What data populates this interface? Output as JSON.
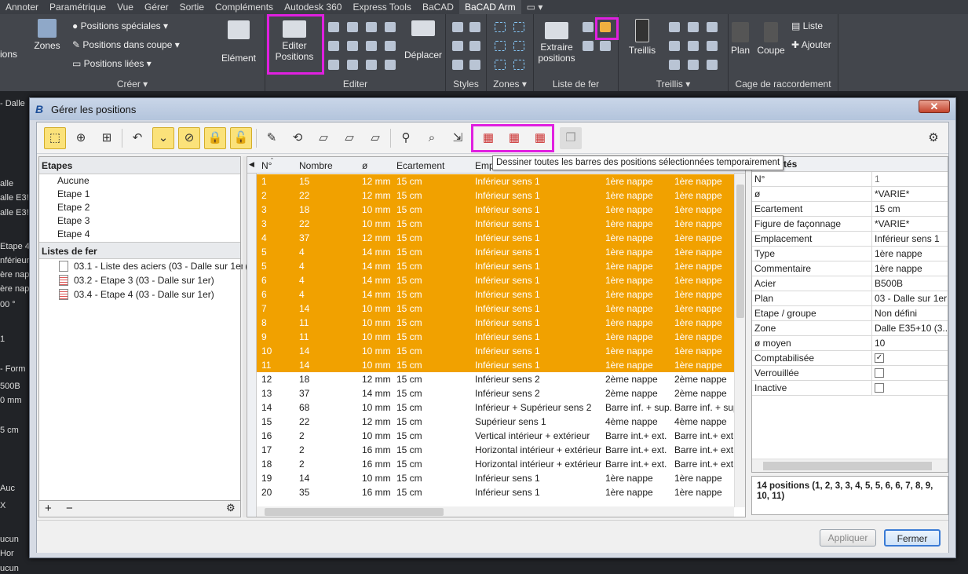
{
  "ribbon_tabs": [
    "Annoter",
    "Paramétrique",
    "Vue",
    "Gérer",
    "Sortie",
    "Compléments",
    "Autodesk 360",
    "Express Tools",
    "BaCAD",
    "BaCAD Arm",
    "▭ ▾"
  ],
  "ribbon": {
    "creer": {
      "label": "Créer ▾",
      "ions": "ions",
      "zones": "Zones",
      "pos_speciales": "Positions spéciales ▾",
      "pos_coupe": "Positions dans coupe ▾",
      "pos_liees": "Positions liées ▾",
      "element": "Elément"
    },
    "editer": {
      "label": "Editer",
      "editer_positions": "Editer Positions",
      "deplacer": "Déplacer"
    },
    "styles": {
      "label": "Styles"
    },
    "zones": {
      "label": "Zones ▾"
    },
    "liste": {
      "label": "Liste de fer",
      "extraire": "Extraire positions"
    },
    "treillis": {
      "label": "Treillis ▾",
      "treillis": "Treillis"
    },
    "cage": {
      "label": "Cage de raccordement",
      "plan": "Plan",
      "coupe": "Coupe",
      "liste": "Liste",
      "ajouter": "Ajouter"
    }
  },
  "left_strip": [
    "- Dalle",
    "alle",
    "alle E3!",
    "alle E3!",
    "Etape 4",
    "nférieur",
    "ère nap",
    "ère nap",
    "00 °",
    "1",
    "- Form",
    "500B",
    "0 mm",
    "5 cm",
    "Auc",
    "X",
    "ucun",
    "Hor",
    "ucun"
  ],
  "dialog": {
    "title": "Gérer les positions",
    "close": "✕",
    "tooltip": "Dessiner toutes les barres des positions sélectionnées temporairement",
    "etapes_header": "Etapes",
    "etapes": [
      "Aucune",
      "Etape 1",
      "Etape 2",
      "Etape 3",
      "Etape 4"
    ],
    "listes_header": "Listes de fer",
    "listes": [
      "03.1 - Liste des aciers (03 - Dalle sur 1er)",
      "03.2 - Etape 3 (03 - Dalle sur 1er)",
      "03.4 - Etape 4 (03 - Dalle sur 1er)"
    ],
    "footer": {
      "plus": "+",
      "minus": "−",
      "gear": "⚙"
    },
    "columns": [
      "N°",
      "Nombre",
      "ø",
      "Ecartement",
      "Emp",
      "",
      "",
      ""
    ],
    "rows": [
      [
        "1",
        "15",
        "12 mm",
        "15 cm",
        "Inférieur sens 1",
        "1ère nappe",
        "1ère nappe"
      ],
      [
        "2",
        "22",
        "12 mm",
        "15 cm",
        "Inférieur sens 1",
        "1ère nappe",
        "1ère nappe"
      ],
      [
        "3",
        "18",
        "10 mm",
        "15 cm",
        "Inférieur sens 1",
        "1ère nappe",
        "1ère nappe"
      ],
      [
        "3",
        "22",
        "10 mm",
        "15 cm",
        "Inférieur sens 1",
        "1ère nappe",
        "1ère nappe"
      ],
      [
        "4",
        "37",
        "12 mm",
        "15 cm",
        "Inférieur sens 1",
        "1ère nappe",
        "1ère nappe"
      ],
      [
        "5",
        "4",
        "14 mm",
        "15 cm",
        "Inférieur sens 1",
        "1ère nappe",
        "1ère nappe"
      ],
      [
        "5",
        "4",
        "14 mm",
        "15 cm",
        "Inférieur sens 1",
        "1ère nappe",
        "1ère nappe"
      ],
      [
        "6",
        "4",
        "14 mm",
        "15 cm",
        "Inférieur sens 1",
        "1ère nappe",
        "1ère nappe"
      ],
      [
        "6",
        "4",
        "14 mm",
        "15 cm",
        "Inférieur sens 1",
        "1ère nappe",
        "1ère nappe"
      ],
      [
        "7",
        "14",
        "10 mm",
        "15 cm",
        "Inférieur sens 1",
        "1ère nappe",
        "1ère nappe"
      ],
      [
        "8",
        "11",
        "10 mm",
        "15 cm",
        "Inférieur sens 1",
        "1ère nappe",
        "1ère nappe"
      ],
      [
        "9",
        "11",
        "10 mm",
        "15 cm",
        "Inférieur sens 1",
        "1ère nappe",
        "1ère nappe"
      ],
      [
        "10",
        "14",
        "10 mm",
        "15 cm",
        "Inférieur sens 1",
        "1ère nappe",
        "1ère nappe"
      ],
      [
        "11",
        "14",
        "10 mm",
        "15 cm",
        "Inférieur sens 1",
        "1ère nappe",
        "1ère nappe"
      ],
      [
        "12",
        "18",
        "12 mm",
        "15 cm",
        "Inférieur sens 2",
        "2ème nappe",
        "2ème nappe"
      ],
      [
        "13",
        "37",
        "14 mm",
        "15 cm",
        "Inférieur sens 2",
        "2ème nappe",
        "2ème nappe"
      ],
      [
        "14",
        "68",
        "10 mm",
        "15 cm",
        "Inférieur + Supérieur sens 2",
        "Barre inf. + sup.",
        "Barre inf. + sup."
      ],
      [
        "15",
        "22",
        "12 mm",
        "15 cm",
        "Supérieur sens 1",
        "4ème nappe",
        "4ème nappe"
      ],
      [
        "16",
        "2",
        "10 mm",
        "15 cm",
        "Vertical intérieur + extérieur",
        "Barre int.+ ext.",
        "Barre int.+ ext."
      ],
      [
        "17",
        "2",
        "16 mm",
        "15 cm",
        "Horizontal intérieur + extérieur",
        "Barre int.+ ext.",
        "Barre int.+ ext."
      ],
      [
        "18",
        "2",
        "16 mm",
        "15 cm",
        "Horizontal intérieur + extérieur",
        "Barre int.+ ext.",
        "Barre int.+ ext."
      ],
      [
        "19",
        "14",
        "10 mm",
        "15 cm",
        "Inférieur sens 1",
        "1ère nappe",
        "1ère nappe"
      ],
      [
        "20",
        "35",
        "16 mm",
        "15 cm",
        "Inférieur sens 1",
        "1ère nappe",
        "1ère nappe"
      ]
    ],
    "props_header": "tés",
    "props": [
      [
        "N°",
        "1"
      ],
      [
        "ø",
        "*VARIE*"
      ],
      [
        "Ecartement",
        "15 cm"
      ],
      [
        "Figure de façonnage",
        "*VARIE*"
      ],
      [
        "Emplacement",
        "Inférieur sens 1"
      ],
      [
        "Type",
        "1ère nappe"
      ],
      [
        "Commentaire",
        "1ère nappe"
      ],
      [
        "Acier",
        "B500B"
      ],
      [
        "Plan",
        "03 - Dalle sur 1er"
      ],
      [
        "Etape / groupe",
        "Non défini"
      ],
      [
        "Zone",
        "Dalle E35+10 (3..."
      ],
      [
        "ø moyen",
        "10"
      ],
      [
        "Comptabilisée",
        "✓"
      ],
      [
        "Verrouillée",
        ""
      ],
      [
        "Inactive",
        ""
      ]
    ],
    "summary": "14 positions (1, 2, 3, 3, 4, 5, 5, 6, 6, 7, 8, 9, 10, 11)",
    "buttons": {
      "apply": "Appliquer",
      "close": "Fermer"
    }
  },
  "colors": {
    "selected_row": "#f1a100",
    "highlight": "#e020e0",
    "ribbon": "#43464c"
  }
}
